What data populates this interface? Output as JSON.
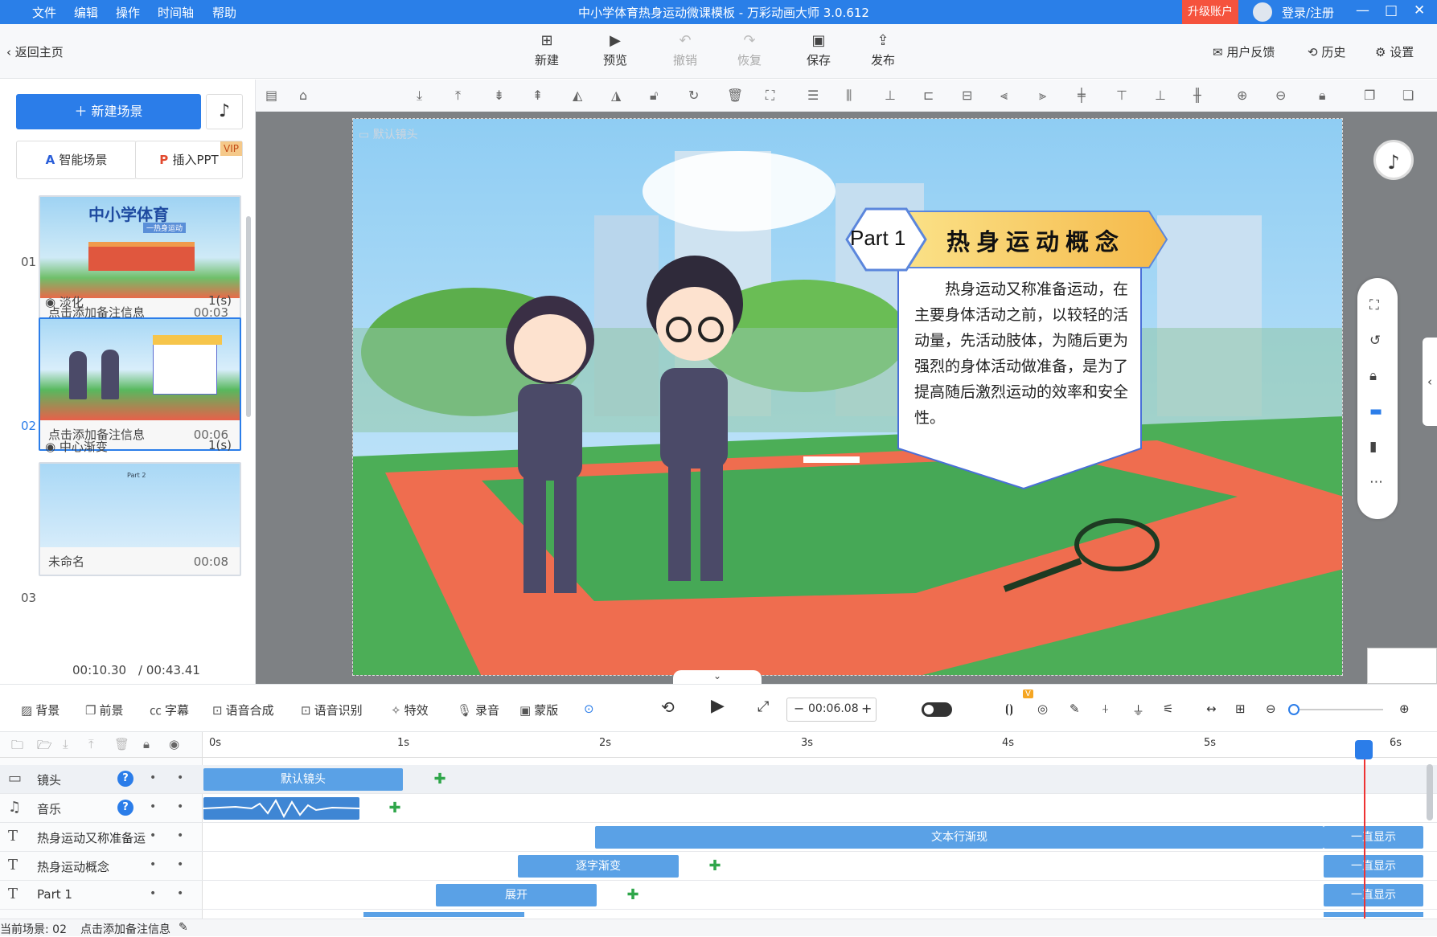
{
  "app": {
    "menu": [
      "文件",
      "编辑",
      "操作",
      "时间轴",
      "帮助"
    ],
    "title": "中小学体育热身运动微课模板 - 万彩动画大师 3.0.612",
    "upgrade": "升级账户",
    "login": "登录/注册"
  },
  "toolbar": {
    "back": "返回主页",
    "buttons": [
      "新建",
      "预览",
      "撤销",
      "恢复",
      "保存",
      "发布"
    ],
    "feedback": "用户反馈",
    "history": "历史",
    "settings": "设置"
  },
  "left": {
    "new_scene": "新建场景",
    "smart_scene": "智能场景",
    "insert_ppt": "插入PPT",
    "vip": "VIP",
    "scenes": [
      {
        "num": "01",
        "title": "点击添加备注信息",
        "duration": "00:03",
        "thumb_title": "中小学体育",
        "thumb_sub": "一热身运动"
      },
      {
        "num": "02",
        "title": "点击添加备注信息",
        "duration": "00:06"
      },
      {
        "num": "03",
        "title": "未命名",
        "duration": "00:08",
        "thumb_title": "Part 2"
      }
    ],
    "transitions": [
      {
        "name": "淡化",
        "duration": "1(s)"
      },
      {
        "name": "中心渐变",
        "duration": "1(s)"
      }
    ],
    "time_current": "00:10.30",
    "time_total": "/ 00:43.41"
  },
  "stage": {
    "camera_label": "默认镜头",
    "part_label": "Part 1",
    "heading": "热身运动概念",
    "body": "热身运动又称准备运动，在主要身体活动之前，以较轻的活动量，先活动肢体，为随后更为强烈的身体活动做准备，是为了提高随后激烈运动的效率和安全性。"
  },
  "controls": {
    "items": [
      "背景",
      "前景",
      "字幕",
      "语音合成",
      "语音识别",
      "特效",
      "录音",
      "蒙版"
    ],
    "time": "00:06.08",
    "vip_badge": "V"
  },
  "timeline": {
    "ticks": [
      "0s",
      "1s",
      "2s",
      "3s",
      "4s",
      "5s",
      "6s"
    ],
    "tracks": [
      {
        "name": "镜头",
        "clips": [
          "默认镜头"
        ]
      },
      {
        "name": "音乐",
        "clips": []
      },
      {
        "name": "热身运动又称准备运",
        "clips": [
          "文本行渐现",
          "一直显示"
        ]
      },
      {
        "name": "热身运动概念",
        "clips": [
          "逐字渐变",
          "一直显示"
        ]
      },
      {
        "name": "Part 1",
        "clips": [
          "展开",
          "一直显示"
        ]
      }
    ]
  },
  "status": {
    "scene": "当前场景: 02",
    "note": "点击添加备注信息"
  },
  "colors": {
    "primary": "#2b7de9",
    "title_bar": "#2a7fe8",
    "upgrade": "#f5533d",
    "clip": "#5aa1e6",
    "keyframe": "#2fa64a",
    "playhead": "#e33333"
  }
}
